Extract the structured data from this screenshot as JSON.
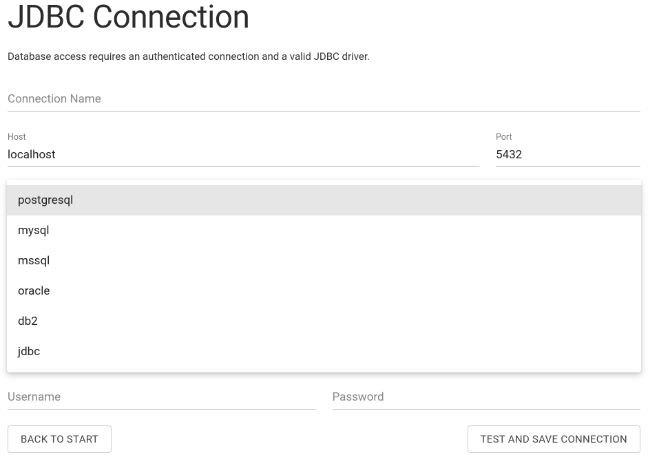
{
  "page": {
    "title": "JDBC Connection",
    "subtitle": "Database access requires an authenticated connection and a valid JDBC driver."
  },
  "fields": {
    "connection_name": {
      "label": "Connection Name",
      "value": ""
    },
    "host": {
      "label": "Host",
      "value": "localhost"
    },
    "port": {
      "label": "Port",
      "value": "5432"
    },
    "username": {
      "label": "Username",
      "value": ""
    },
    "password": {
      "label": "Password",
      "value": ""
    }
  },
  "dropdown": {
    "options": [
      {
        "label": "postgresql",
        "selected": true
      },
      {
        "label": "mysql",
        "selected": false
      },
      {
        "label": "mssql",
        "selected": false
      },
      {
        "label": "oracle",
        "selected": false
      },
      {
        "label": "db2",
        "selected": false
      },
      {
        "label": "jdbc",
        "selected": false
      }
    ]
  },
  "buttons": {
    "back": "BACK TO START",
    "test_save": "TEST AND SAVE CONNECTION"
  }
}
